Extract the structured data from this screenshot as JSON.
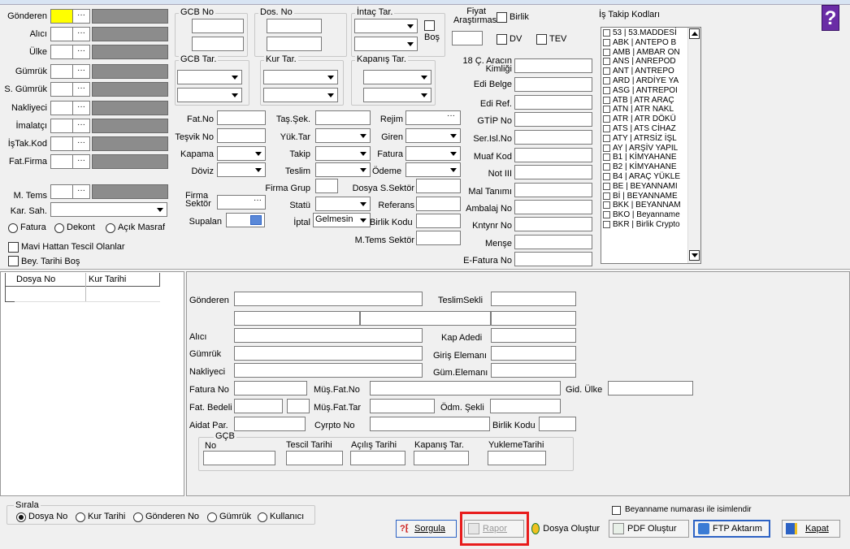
{
  "top": {
    "gonderen_label": "Gönderen",
    "alici_label": "Alıcı",
    "ulke_label": "Ülke",
    "gumruk_label": "Gümrük",
    "s_gumruk_label": "S. Gümrük",
    "nakliyeci_label": "Nakliyeci",
    "imalatci_label": "İmalatçı",
    "istak_label": "İşTak.Kod",
    "fatfirma_label": "Fat.Firma",
    "mtems_label": "M. Tems",
    "karsah_label": "Kar. Sah.",
    "dots": "···",
    "radio_fatura": "Fatura",
    "radio_dekont": "Dekont",
    "radio_acik": "Açık Masraf",
    "chk_mavi": "Mavi Hattan Tescil Olanlar",
    "chk_bey": "Bey. Tarihi Boş"
  },
  "groups": {
    "gcb_no": "GCB No",
    "dos_no": "Dos. No",
    "intac": "İntaç Tar.",
    "bos": "Boş",
    "fiyat": "Fiyat\nAraştırması",
    "birlik": "Birlik",
    "dv": "DV",
    "tev": "TEV",
    "is_takip": "İş Takip Kodları",
    "gcb_tar": "GCB Tar.",
    "kur_tar": "Kur Tar.",
    "kapanis": "Kapanış Tar.",
    "arac": "18 Ç. Aracın\nKimliği"
  },
  "mid": {
    "fatno": "Fat.No",
    "tesvik": "Teşvik No",
    "kapama": "Kapama",
    "doviz": "Döviz",
    "firma_sektor": "Firma\nSektör",
    "supalan": "Supalan",
    "tas_sek": "Taş.Şek.",
    "yuk_tar": "Yük.Tar",
    "takip": "Takip",
    "teslim": "Teslim",
    "firma_grup": "Firma Grup",
    "statu": "Statü",
    "iptal": "İptal",
    "iptal_val": "Gelmesin",
    "rejim": "Rejim",
    "giren": "Giren",
    "fatura": "Fatura",
    "odeme": "Ödeme",
    "dosya_s_sektor": "Dosya S.Sektör",
    "referans": "Referans",
    "birlik_kodu": "Birlik Kodu",
    "mtems_sektor": "M.Tems Sektör",
    "edi_belge": "Edi Belge",
    "edi_ref": "Edi Ref.",
    "gtip": "GTİP No",
    "ser_isl": "Ser.Isl.No",
    "muaf": "Muaf Kod",
    "not3": "Not III",
    "mal": "Mal Tanımı",
    "ambalaj": "Ambalaj No",
    "kntynr": "Kntynr No",
    "mense": "Menşe",
    "efatura": "E-Fatura No"
  },
  "takip_list": [
    "53 | 53.MADDESİ",
    "ABK | ANTEPO B",
    "AMB | AMBAR ON",
    "ANS | ANREPOD",
    "ANT | ANTREPO",
    "ARD | ARDİYE YA",
    "ASG | ANTREPOI",
    "ATB | ATR ARAÇ",
    "ATN | ATR NAKL",
    "ATR | ATR DÖKÜ",
    "ATS | ATS CİHAZ",
    "ATY | ATRSİZ İŞL",
    "AY | ARŞİV YAPIL",
    "B1 | KİMYAHANE",
    "B2 | KİMYAHANE",
    "B4 | ARAÇ YÜKLE",
    "BE | BEYANNAMI",
    "Bİ | BEYANNAME",
    "BKK | BEYANNAM",
    "BKO | Beyanname",
    "BKR | Birlik Crypto"
  ],
  "grid": {
    "col1": "Dosya No",
    "col2": "Kur Tarihi"
  },
  "detail": {
    "gonderen": "Gönderen",
    "teslim_sekli": "TeslimSekli",
    "alici": "Alıcı",
    "kap_adedi": "Kap Adedi",
    "gumruk": "Gümrük",
    "giris_eleman": "Giriş Elemanı",
    "nakliyeci": "Nakliyeci",
    "gum_eleman": "Güm.Elemanı",
    "fatura_no": "Fatura No",
    "mus_fat_no": "Müş.Fat.No",
    "gid_ulke": "Gid. Ülke",
    "fat_bedeli": "Fat. Bedeli",
    "mus_fat_tar": "Müş.Fat.Tar",
    "odm_sekli": "Ödm. Şekli",
    "aidat": "Aidat Par.",
    "cyrpto": "Cyrpto No",
    "birlik_kodu": "Birlik Kodu",
    "gcb_title": "GÇB",
    "no": "No",
    "tescil": "Tescil Tarihi",
    "acilis": "Açılış Tarihi",
    "kapanis": "Kapanış Tar.",
    "yukleme": "YuklemeTarihi"
  },
  "bottom": {
    "sirala": "Sırala",
    "opt1": "Dosya No",
    "opt2": "Kur Tarihi",
    "opt3": "Gönderen No",
    "opt4": "Gümrük",
    "opt5": "Kullanıcı",
    "beyanname_chk": "Beyanname numarası ile isimlendir",
    "sorgula": "Sorgula",
    "rapor": "Rapor",
    "dosya_olustur": "Dosya Oluştur",
    "pdf_olustur": "PDF Oluştur",
    "ftp": "FTP Aktarım",
    "kapat": "Kapat"
  },
  "colors": {
    "accent": "#2c62c4",
    "highlight": "#e81c1c",
    "help_bg": "#6a2ca6",
    "yellow": "#ffff00"
  }
}
